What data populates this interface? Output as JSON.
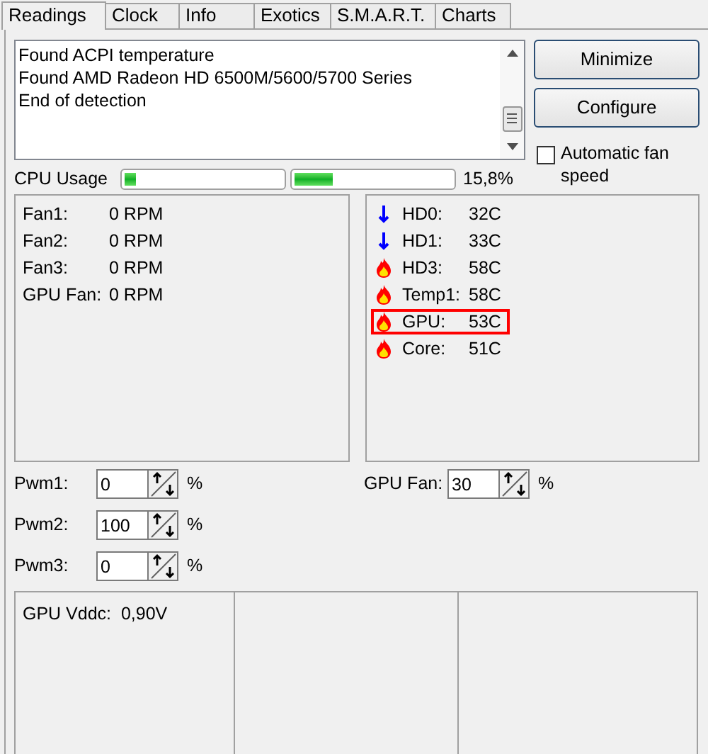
{
  "tabs": [
    {
      "label": "Readings",
      "selected": true
    },
    {
      "label": "Clock",
      "selected": false
    },
    {
      "label": "Info",
      "selected": false
    },
    {
      "label": "Exotics",
      "selected": false
    },
    {
      "label": "S.M.A.R.T.",
      "selected": false
    },
    {
      "label": "Charts",
      "selected": false
    }
  ],
  "log": [
    "Found ACPI temperature",
    "Found AMD Radeon HD 6500M/5600/5700 Series",
    "End of detection"
  ],
  "buttons": [
    "Minimize",
    "Configure"
  ],
  "automatic_fan_speed": {
    "label": "Automatic fan speed",
    "checked": false
  },
  "cpu_usage": {
    "label": "CPU Usage",
    "bars": [
      {
        "level": 0.07
      },
      {
        "level": 0.24
      }
    ],
    "reading": "15,8%"
  },
  "fans": [
    {
      "label": "Fan1:",
      "value": "0 RPM"
    },
    {
      "label": "Fan2:",
      "value": "0 RPM"
    },
    {
      "label": "Fan3:",
      "value": "0 RPM"
    },
    {
      "label": "GPU Fan:",
      "value": "0 RPM"
    }
  ],
  "temperatures": [
    {
      "kind": "down",
      "label": "HD0:",
      "value": "32C",
      "highlighted": false
    },
    {
      "kind": "down",
      "label": "HD1:",
      "value": "33C",
      "highlighted": false
    },
    {
      "kind": "hot",
      "label": "HD3:",
      "value": "58C",
      "highlighted": false
    },
    {
      "kind": "hot",
      "label": "Temp1:",
      "value": "58C",
      "highlighted": false
    },
    {
      "kind": "hot",
      "label": "GPU:",
      "value": "53C",
      "highlighted": true
    },
    {
      "kind": "hot",
      "label": "Core:",
      "value": "51C",
      "highlighted": false
    }
  ],
  "pwm": [
    {
      "label": "Pwm1:",
      "value": "0",
      "unit": "%"
    },
    {
      "label": "Pwm2:",
      "value": "100",
      "unit": "%"
    },
    {
      "label": "Pwm3:",
      "value": "0",
      "unit": "%"
    }
  ],
  "gpu_fan": {
    "label": "GPU Fan:",
    "value": "30",
    "unit": "%"
  },
  "bottom_panel": {
    "column_1": "GPU Vddc:  0,90V"
  }
}
